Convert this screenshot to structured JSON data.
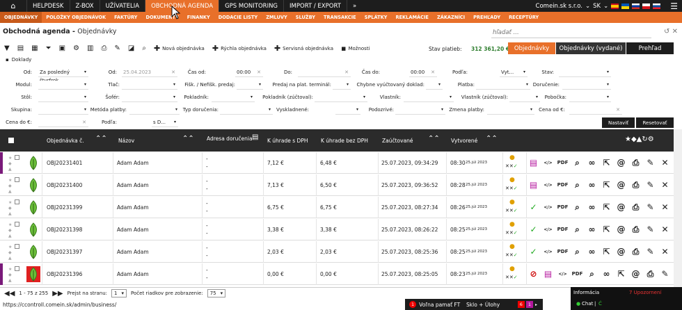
{
  "topnav": {
    "items": [
      {
        "label": "HELPDESK"
      },
      {
        "label": "Z-BOX"
      },
      {
        "label": "UŽÍVATELIA"
      },
      {
        "label": "OBCHODNÁ AGENDA",
        "active": true
      },
      {
        "label": "GPS MONITORING"
      },
      {
        "label": "IMPORT / EXPORT"
      },
      {
        "label": "»"
      }
    ],
    "company": "Comein.sk s.r.o.",
    "lang": "SK"
  },
  "subnav": {
    "items": [
      {
        "label": "OBJEDNÁVKY",
        "active": true
      },
      {
        "label": "POLOŽKY OBJEDNÁVOK"
      },
      {
        "label": "FAKTÚRY"
      },
      {
        "label": "DOKUMENTY"
      },
      {
        "label": "FINANKY"
      },
      {
        "label": "DODACIE LISTY"
      },
      {
        "label": "ZMLUVY"
      },
      {
        "label": "SLUŽBY"
      },
      {
        "label": "TRANSAKCIE"
      },
      {
        "label": "SPLÁTKY"
      },
      {
        "label": "REKLAMÁCIE"
      },
      {
        "label": "ZÁKAZNÍCI"
      },
      {
        "label": "PREHĽADY"
      },
      {
        "label": "RECEPTÚRY"
      }
    ]
  },
  "breadcrumb": {
    "section": "Obchodná agenda",
    "page": "Objednávky"
  },
  "search": {
    "placeholder": "hľadať ..."
  },
  "toolbar": {
    "new_order": "Nová objednávka",
    "quick_order": "Rýchla objednávka",
    "service_order": "Servisná objednávka",
    "options": "Možnosti",
    "doklady": "Doklady"
  },
  "payments": {
    "label": "Stav platieb:",
    "value": "312 361,20 €"
  },
  "views": {
    "orders": "Objednávky",
    "issued": "Objednávky (vydané)",
    "overview": "Prehľad"
  },
  "filters": {
    "od_label": "Od:",
    "od_value": "Za posledný štvrťrok",
    "od2_label": "Od:",
    "od2_value": "25.04.2023",
    "cas_od_label": "Čas od:",
    "cas_od_value": "00:00",
    "do_label": "Do:",
    "cas_do_label": "Čas do:",
    "cas_do_value": "00:00",
    "podla_label": "Podľa:",
    "podla_value": "Vyt...",
    "stav_label": "Stav:",
    "modul_label": "Modul:",
    "tlac_label": "Tlač:",
    "fisk_label": "Fišk. / Nefišk. predaj:",
    "predaj_label": "Predaj na plat. terminál:",
    "chybne_label": "Chybne vyúčtovaný doklad:",
    "platba_label": "Platba:",
    "dorucenie_label": "Doručenie:",
    "stol_label": "Stôl:",
    "sofer_label": "Šofér:",
    "pokladnik_label": "Pokladník:",
    "pokladnik_z_label": "Pokladník (zúčtoval):",
    "vlastnik_label": "Vlastník:",
    "vlastnik_z_label": "Vlastník (zúčtoval):",
    "pobocka_label": "Pobočka:",
    "skupina_label": "Skupina:",
    "metoda_label": "Metóda platby:",
    "typ_label": "Typ doručenia:",
    "vyskladnene_label": "Vyskladnené:",
    "podozrive_label": "Podozrivé:",
    "zmena_label": "Zmena platby:",
    "cena_od_label": "Cena od €:",
    "cena_do_label": "Cena do €:",
    "podla2_label": "Podľa:",
    "podla2_value": "s D...",
    "nastavit": "Nastaviť",
    "resetovat": "Resetovať"
  },
  "table": {
    "headers": {
      "order_no": "Objednávka č.",
      "name": "Názov",
      "address": "Adresa doručenia",
      "with_vat": "K úhrade s DPH",
      "without_vat": "K úhrade bez DPH",
      "posted": "Zaúčtované",
      "created": "Vytvorené"
    },
    "rows": [
      {
        "no": "OBJ20231401",
        "name": "Adam Adam",
        "addr": "-",
        "with_vat": "7,12 €",
        "without_vat": "6,48 €",
        "posted": "25.07.2023, 09:34:29",
        "time": "08:30",
        "date": "25.júl 2023",
        "status": "open",
        "bar": "#7a1a7a",
        "leaf": "green"
      },
      {
        "no": "OBJ20231400",
        "name": "Adam Adam",
        "addr": "-",
        "with_vat": "7,13 €",
        "without_vat": "6,50 €",
        "posted": "25.07.2023, 09:36:52",
        "time": "08:28",
        "date": "25.júl 2023",
        "status": "open",
        "bar": "",
        "leaf": "green"
      },
      {
        "no": "OBJ20231399",
        "name": "Adam Adam",
        "addr": "-",
        "with_vat": "6,75 €",
        "without_vat": "6,75 €",
        "posted": "25.07.2023, 08:27:34",
        "time": "08:26",
        "date": "25.júl 2023",
        "status": "ok",
        "bar": "",
        "leaf": "green"
      },
      {
        "no": "OBJ20231398",
        "name": "Adam Adam",
        "addr": "-",
        "with_vat": "3,38 €",
        "without_vat": "3,38 €",
        "posted": "25.07.2023, 08:26:22",
        "time": "08:25",
        "date": "25.júl 2023",
        "status": "ok",
        "bar": "",
        "leaf": "green"
      },
      {
        "no": "OBJ20231397",
        "name": "Adam Adam",
        "addr": "-",
        "with_vat": "2,03 €",
        "without_vat": "2,03 €",
        "posted": "25.07.2023, 08:25:36",
        "time": "08:25",
        "date": "25.júl 2023",
        "status": "ok",
        "bar": "",
        "leaf": "green"
      },
      {
        "no": "OBJ20231396",
        "name": "Adam Adam",
        "addr": "-",
        "with_vat": "0,00 €",
        "without_vat": "0,00 €",
        "posted": "25.07.2023, 08:25:05",
        "time": "08:23",
        "date": "25.júl 2023",
        "status": "cancel",
        "bar": "#7a1a7a",
        "leaf": "red"
      }
    ]
  },
  "pagination": {
    "range": "1 - 75 z 255",
    "goto_label": "Prejst na stranu:",
    "page": "1",
    "per_page_label": "Počet riadkov pre zobrazenie:",
    "per_page": "75"
  },
  "infopanel": {
    "title": "Informácia",
    "alerts": "7 Upozornení",
    "chat": "Chat",
    "online": "Ć"
  },
  "statusbar": {
    "url": "https://ccontroll.comein.sk/admin/business/",
    "memory_count": "1",
    "memory_label": "Voľna pamať FT",
    "glass": "Sklo + Úlohy",
    "b1": "6",
    "b2": "1"
  },
  "colors": {
    "accent": "#e8702a",
    "dark": "#1d1d1d",
    "green": "#2d7d2d",
    "magenta": "#b5179e"
  }
}
